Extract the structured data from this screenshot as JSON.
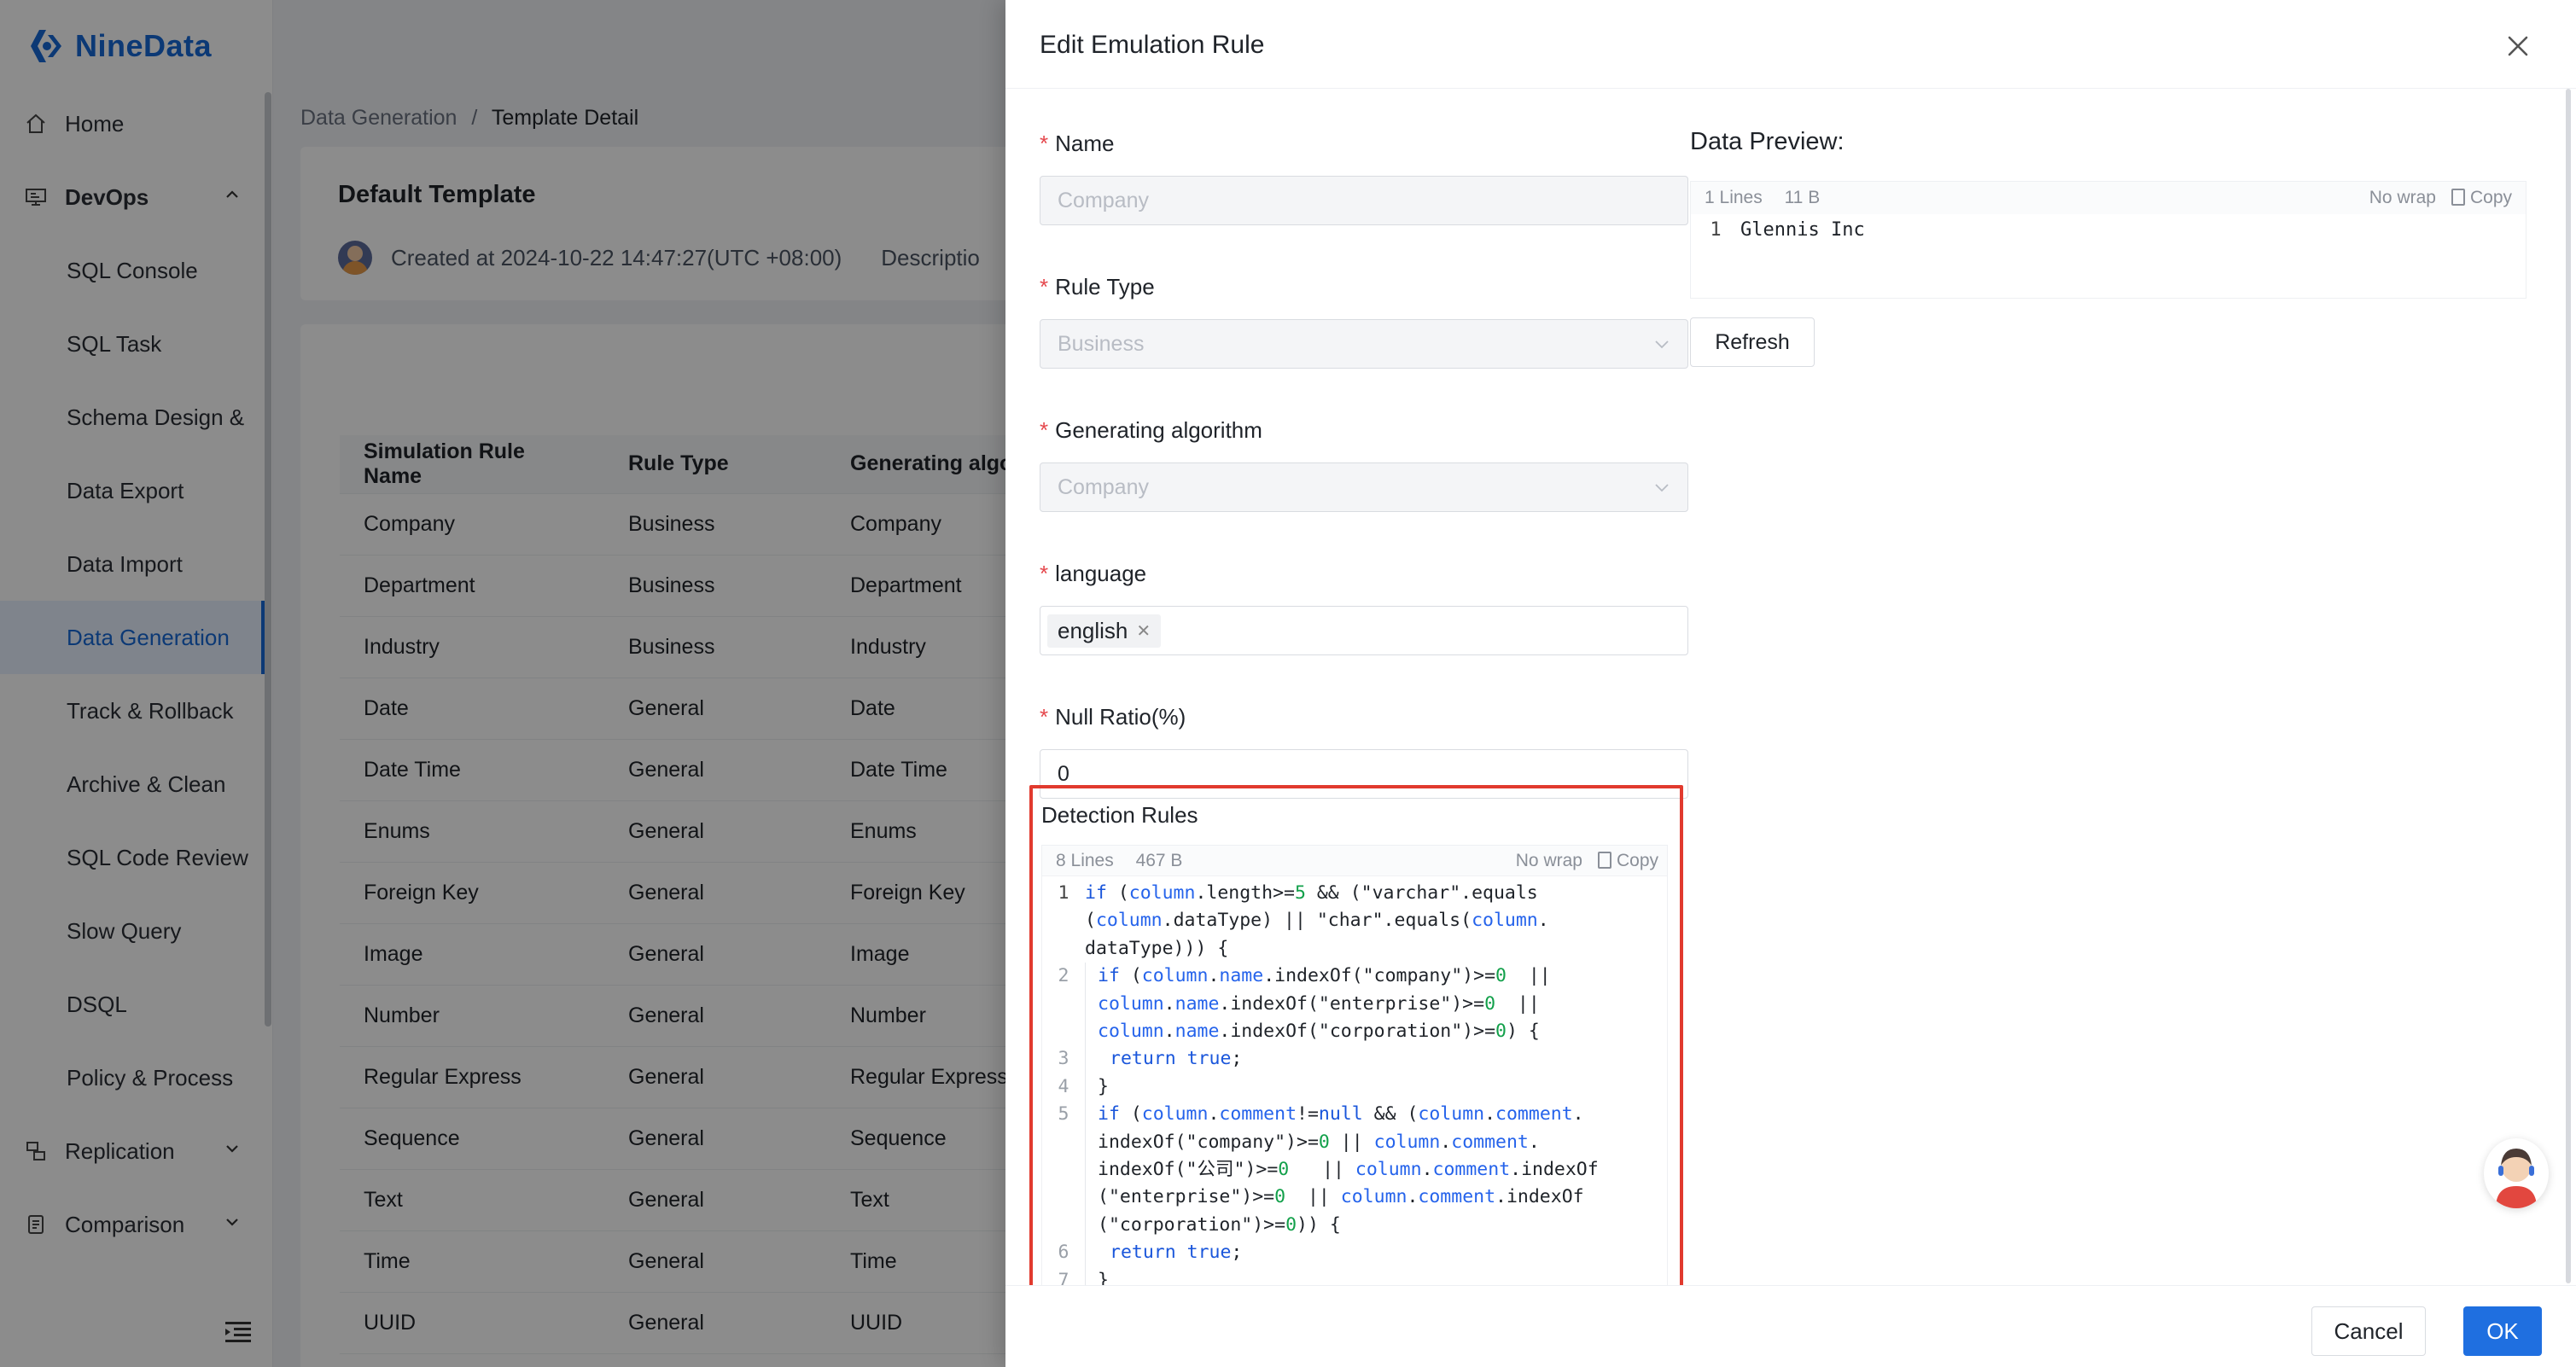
{
  "app": {
    "brand": "NineData"
  },
  "sidebar": {
    "items": [
      {
        "label": "Home",
        "type": "top",
        "icon": "home-icon"
      },
      {
        "label": "DevOps",
        "type": "group",
        "icon": "devops-icon",
        "expanded": true
      },
      {
        "label": "SQL Console",
        "type": "sub"
      },
      {
        "label": "SQL Task",
        "type": "sub"
      },
      {
        "label": "Schema Design &",
        "type": "sub"
      },
      {
        "label": "Data Export",
        "type": "sub"
      },
      {
        "label": "Data Import",
        "type": "sub"
      },
      {
        "label": "Data Generation",
        "type": "sub",
        "active": true
      },
      {
        "label": "Track & Rollback",
        "type": "sub"
      },
      {
        "label": "Archive & Clean",
        "type": "sub"
      },
      {
        "label": "SQL Code Review",
        "type": "sub"
      },
      {
        "label": "Slow Query",
        "type": "sub"
      },
      {
        "label": "DSQL",
        "type": "sub"
      },
      {
        "label": "Policy & Process",
        "type": "sub"
      },
      {
        "label": "Replication",
        "type": "group-collapsed",
        "icon": "replication-icon"
      },
      {
        "label": "Comparison",
        "type": "group-collapsed",
        "icon": "comparison-icon"
      }
    ]
  },
  "breadcrumb": {
    "parent": "Data Generation",
    "separator": "/",
    "current": "Template Detail"
  },
  "template": {
    "title": "Default Template",
    "created": "Created at 2024-10-22 14:47:27(UTC +08:00)",
    "description_label": "Descriptio"
  },
  "table": {
    "headers": [
      "Simulation Rule Name",
      "Rule Type",
      "Generating algo"
    ],
    "rows": [
      [
        "Company",
        "Business",
        "Company"
      ],
      [
        "Department",
        "Business",
        "Department"
      ],
      [
        "Industry",
        "Business",
        "Industry"
      ],
      [
        "Date",
        "General",
        "Date"
      ],
      [
        "Date Time",
        "General",
        "Date Time"
      ],
      [
        "Enums",
        "General",
        "Enums"
      ],
      [
        "Foreign Key",
        "General",
        "Foreign Key"
      ],
      [
        "Image",
        "General",
        "Image"
      ],
      [
        "Number",
        "General",
        "Number"
      ],
      [
        "Regular Express",
        "General",
        "Regular Express"
      ],
      [
        "Sequence",
        "General",
        "Sequence"
      ],
      [
        "Text",
        "General",
        "Text"
      ],
      [
        "Time",
        "General",
        "Time"
      ],
      [
        "UUID",
        "General",
        "UUID"
      ]
    ]
  },
  "drawer": {
    "title": "Edit Emulation Rule",
    "form": {
      "name": {
        "label": "Name",
        "placeholder": "Company"
      },
      "rule_type": {
        "label": "Rule Type",
        "value": "Business"
      },
      "algorithm": {
        "label": "Generating algorithm",
        "value": "Company"
      },
      "language": {
        "label": "language",
        "tag": "english"
      },
      "null_ratio": {
        "label": "Null Ratio(%)",
        "value": "0"
      }
    },
    "detection": {
      "label": "Detection Rules",
      "meta_lines": "8 Lines",
      "meta_size": "467 B",
      "no_wrap": "No wrap",
      "copy": "Copy"
    },
    "preview": {
      "title": "Data Preview:",
      "meta_lines": "1 Lines",
      "meta_size": "11 B",
      "no_wrap": "No wrap",
      "copy": "Copy",
      "line_no": "1",
      "value": "Glennis Inc",
      "refresh": "Refresh"
    },
    "footer": {
      "cancel": "Cancel",
      "ok": "OK"
    }
  },
  "code_lines": [
    {
      "n": "1",
      "indent": 0,
      "segs": [
        [
          "kw",
          "if"
        ],
        [
          "t",
          " ("
        ],
        [
          "var",
          "column"
        ],
        [
          "t",
          "."
        ],
        [
          "t",
          "length>="
        ],
        [
          "num",
          "5"
        ],
        [
          "t",
          " && (\"varchar\".equals"
        ]
      ]
    },
    {
      "n": "",
      "indent": 0,
      "segs": [
        [
          "t",
          "("
        ],
        [
          "var",
          "column"
        ],
        [
          "t",
          ".dataType) || \"char\".equals("
        ],
        [
          "var",
          "column"
        ],
        [
          "t",
          "."
        ]
      ]
    },
    {
      "n": "",
      "indent": 0,
      "segs": [
        [
          "t",
          "dataType))) {"
        ]
      ]
    },
    {
      "n": "2",
      "indent": 1,
      "segs": [
        [
          "kw",
          "if"
        ],
        [
          "t",
          " ("
        ],
        [
          "var",
          "column"
        ],
        [
          "t",
          "."
        ],
        [
          "var",
          "name"
        ],
        [
          "t",
          ".indexOf(\"company\")>="
        ],
        [
          "num",
          "0"
        ],
        [
          "t",
          "  ||"
        ]
      ]
    },
    {
      "n": "",
      "indent": 1,
      "segs": [
        [
          "var",
          "column"
        ],
        [
          "t",
          "."
        ],
        [
          "var",
          "name"
        ],
        [
          "t",
          ".indexOf(\"enterprise\")>="
        ],
        [
          "num",
          "0"
        ],
        [
          "t",
          "  ||"
        ]
      ]
    },
    {
      "n": "",
      "indent": 1,
      "segs": [
        [
          "var",
          "column"
        ],
        [
          "t",
          "."
        ],
        [
          "var",
          "name"
        ],
        [
          "t",
          ".indexOf(\"corporation\")>="
        ],
        [
          "num",
          "0"
        ],
        [
          "t",
          ") {"
        ]
      ]
    },
    {
      "n": "3",
      "indent": 2,
      "segs": [
        [
          "kw",
          "return"
        ],
        [
          "t",
          " "
        ],
        [
          "kw",
          "true"
        ],
        [
          "t",
          ";"
        ]
      ]
    },
    {
      "n": "4",
      "indent": 1,
      "segs": [
        [
          "t",
          "}"
        ]
      ]
    },
    {
      "n": "5",
      "indent": 1,
      "segs": [
        [
          "kw",
          "if"
        ],
        [
          "t",
          " ("
        ],
        [
          "var",
          "column"
        ],
        [
          "t",
          "."
        ],
        [
          "var",
          "comment"
        ],
        [
          "t",
          "!="
        ],
        [
          "kw",
          "null"
        ],
        [
          "t",
          " && ("
        ],
        [
          "var",
          "column"
        ],
        [
          "t",
          "."
        ],
        [
          "var",
          "comment"
        ],
        [
          "t",
          "."
        ]
      ]
    },
    {
      "n": "",
      "indent": 1,
      "segs": [
        [
          "t",
          "indexOf(\"company\")>="
        ],
        [
          "num",
          "0"
        ],
        [
          "t",
          " || "
        ],
        [
          "var",
          "column"
        ],
        [
          "t",
          "."
        ],
        [
          "var",
          "comment"
        ],
        [
          "t",
          "."
        ]
      ]
    },
    {
      "n": "",
      "indent": 1,
      "segs": [
        [
          "t",
          "indexOf(\"公司\")>="
        ],
        [
          "num",
          "0"
        ],
        [
          "t",
          "   || "
        ],
        [
          "var",
          "column"
        ],
        [
          "t",
          "."
        ],
        [
          "var",
          "comment"
        ],
        [
          "t",
          ".indexOf"
        ]
      ]
    },
    {
      "n": "",
      "indent": 1,
      "segs": [
        [
          "t",
          "(\"enterprise\")>="
        ],
        [
          "num",
          "0"
        ],
        [
          "t",
          "  || "
        ],
        [
          "var",
          "column"
        ],
        [
          "t",
          "."
        ],
        [
          "var",
          "comment"
        ],
        [
          "t",
          ".indexOf"
        ]
      ]
    },
    {
      "n": "",
      "indent": 1,
      "segs": [
        [
          "t",
          "(\"corporation\")>="
        ],
        [
          "num",
          "0"
        ],
        [
          "t",
          ")) {"
        ]
      ]
    },
    {
      "n": "6",
      "indent": 2,
      "segs": [
        [
          "kw",
          "return"
        ],
        [
          "t",
          " "
        ],
        [
          "kw",
          "true"
        ],
        [
          "t",
          ";"
        ]
      ]
    },
    {
      "n": "7",
      "indent": 1,
      "segs": [
        [
          "t",
          "}"
        ]
      ]
    }
  ]
}
